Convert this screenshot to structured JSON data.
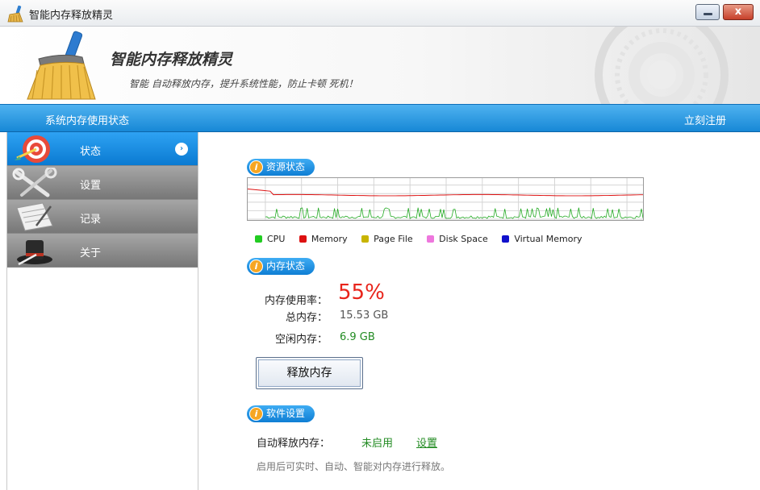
{
  "window": {
    "title": "智能内存释放精灵",
    "close_symbol": "x",
    "icons": [
      "broom-icon",
      "minimize-icon",
      "close-icon"
    ]
  },
  "banner": {
    "title": "智能内存释放精灵",
    "subtitle": "智能 自动释放内存，提升系统性能，防止卡顿 死机！"
  },
  "statusbar": {
    "left_text": "系统内存使用状态",
    "register_link": "立刻注册"
  },
  "sidebar": {
    "items": [
      {
        "label": "状态",
        "icon": "target-icon",
        "active": true,
        "arrow": "›"
      },
      {
        "label": "设置",
        "icon": "tools-icon",
        "active": false
      },
      {
        "label": "记录",
        "icon": "notebook-icon",
        "active": false
      },
      {
        "label": "关于",
        "icon": "magic-hat-icon",
        "active": false
      }
    ]
  },
  "resource": {
    "section_title": "资源状态",
    "info_symbol": "i",
    "legend": [
      {
        "label": "CPU",
        "color": "#22cc22"
      },
      {
        "label": "Memory",
        "color": "#dd1111"
      },
      {
        "label": "Page File",
        "color": "#c8b400"
      },
      {
        "label": "Disk Space",
        "color": "#ee77dd"
      },
      {
        "label": "Virtual Memory",
        "color": "#1111cc"
      }
    ]
  },
  "memory": {
    "section_title": "内存状态",
    "usage_label": "内存使用率：",
    "usage_value": "55%",
    "total_label": "总内存：",
    "total_value": "15.53 GB",
    "free_label": "空闲内存：",
    "free_value": "6.9 GB",
    "release_button": "释放内存"
  },
  "software": {
    "section_title": "软件设置",
    "auto_label": "自动释放内存：",
    "auto_status": "未启用",
    "settings_link": "设置",
    "description": "启用后可实时、自动、智能对内存进行释放。"
  },
  "colors": {
    "accent_blue": "#1788d6",
    "usage_red": "#e8241b",
    "value_green": "#228b22"
  }
}
